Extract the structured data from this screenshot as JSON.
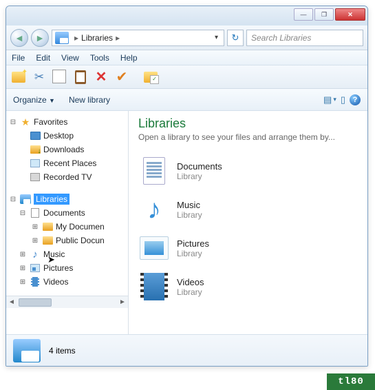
{
  "titlebar": {
    "min": "—",
    "max": "❐",
    "close": "✕"
  },
  "nav": {
    "back": "◄",
    "forward": "►",
    "breadcrumb": [
      "Libraries"
    ],
    "search_placeholder": "Search Libraries"
  },
  "menu": {
    "items": [
      "File",
      "Edit",
      "View",
      "Tools",
      "Help"
    ]
  },
  "toolbar": {
    "items": [
      "new-folder",
      "cut",
      "copy",
      "paste",
      "delete",
      "check",
      "properties"
    ]
  },
  "cmdbar": {
    "organize": "Organize",
    "newlib": "New library"
  },
  "sidebar": {
    "favorites_label": "Favorites",
    "favorites": [
      {
        "label": "Desktop",
        "icon": "mon"
      },
      {
        "label": "Downloads",
        "icon": "fold-dl"
      },
      {
        "label": "Recent Places",
        "icon": "recent"
      },
      {
        "label": "Recorded TV",
        "icon": "tv"
      }
    ],
    "libraries_label": "Libraries",
    "libraries": [
      {
        "label": "Documents",
        "icon": "doc-s",
        "expanded": true,
        "children": [
          {
            "label": "My Documen",
            "icon": "fold-s"
          },
          {
            "label": "Public Docun",
            "icon": "fold-s"
          }
        ]
      },
      {
        "label": "Music",
        "icon": "note"
      },
      {
        "label": "Pictures",
        "icon": "pic-s"
      },
      {
        "label": "Videos",
        "icon": "vid-s"
      }
    ]
  },
  "main": {
    "heading": "Libraries",
    "subtitle": "Open a library to see your files and arrange them by...",
    "type_label": "Library",
    "items": [
      {
        "name": "Documents",
        "icon": "doc-b"
      },
      {
        "name": "Music",
        "icon": "mus-b"
      },
      {
        "name": "Pictures",
        "icon": "pic-b"
      },
      {
        "name": "Videos",
        "icon": "vid-b"
      }
    ]
  },
  "status": {
    "count": "4 items"
  },
  "watermark": "tl80"
}
